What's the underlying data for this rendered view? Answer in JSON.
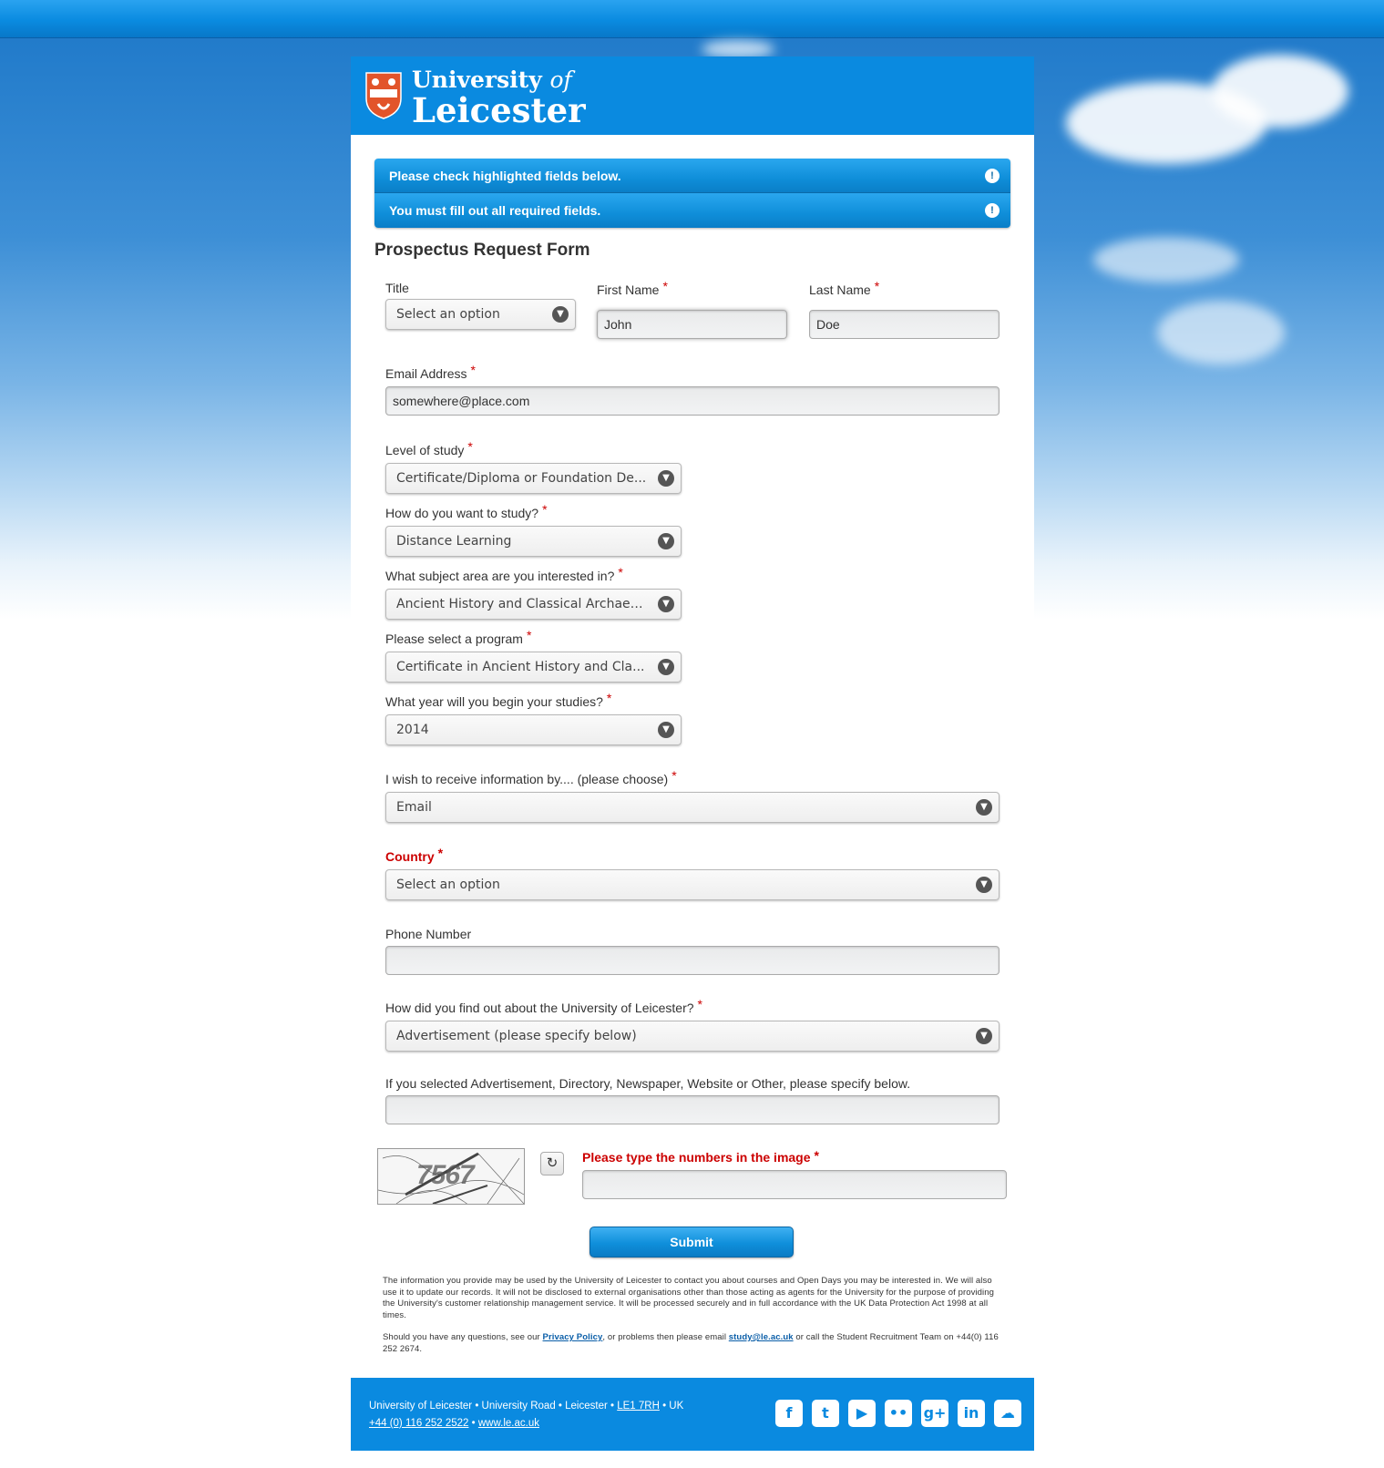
{
  "header": {
    "logo_line1": "University ",
    "logo_of": "of",
    "logo_line2": "Leicester"
  },
  "alerts": [
    "Please check highlighted fields below.",
    "You must fill out all required fields."
  ],
  "form_title": "Prospectus Request Form",
  "fields": {
    "title": {
      "label": "Title",
      "value": "Select an option"
    },
    "first_name": {
      "label": "First Name",
      "value": "John"
    },
    "last_name": {
      "label": "Last Name",
      "value": "Doe"
    },
    "email": {
      "label": "Email Address",
      "value": "somewhere@place.com"
    },
    "level": {
      "label": "Level of study",
      "value": "Certificate/Diploma or Foundation De..."
    },
    "how_study": {
      "label": "How do you want to study?",
      "value": "Distance Learning"
    },
    "subject": {
      "label": "What subject area are you interested in?",
      "value": "Ancient History and Classical Archaeo..."
    },
    "program": {
      "label": "Please select a program",
      "value": "Certificate in Ancient History and Cla..."
    },
    "year": {
      "label": "What year will you begin your studies?",
      "value": "2014"
    },
    "receive_by": {
      "label": "I wish to receive information by.... (please choose)",
      "value": "Email"
    },
    "country": {
      "label": "Country",
      "value": "Select an option"
    },
    "phone": {
      "label": "Phone Number",
      "value": ""
    },
    "found_out": {
      "label": "How did you find out about the University of Leicester?",
      "value": "Advertisement (please specify below)"
    },
    "specify": {
      "label": "If you selected Advertisement, Directory, Newspaper, Website or Other, please specify below.",
      "value": ""
    },
    "captcha": {
      "label": "Please type the numbers in the image",
      "image_text": "7567",
      "value": ""
    }
  },
  "required_mark": "*",
  "submit_label": "Submit",
  "fine_print": {
    "para1": "The information you provide may be used by the University of Leicester to contact you about courses and Open Days you may be interested in. We will also use it to update our records. It will not be disclosed to external organisations other than those acting as agents for the University for the purpose of providing the University's customer relationship management service. It will be processed securely and in full accordance with the UK Data Protection Act 1998 at all times.",
    "para2_a": "Should you have any questions, see our ",
    "privacy_link": "Privacy Policy",
    "para2_b": ", or problems then please email ",
    "email_link": "study@le.ac.uk",
    "para2_c": " or call the Student Recruitment Team on +44(0) 116 252 2674."
  },
  "footer": {
    "addr_a": "University of Leicester • University Road • Leicester • ",
    "postcode": "LE1 7RH",
    "addr_b": " • UK",
    "phone": "+44 (0) 116 252 2522",
    "sep": " • ",
    "website": "www.le.ac.uk",
    "social": [
      "facebook-icon",
      "twitter-icon",
      "youtube-icon",
      "flickr-icon",
      "googleplus-icon",
      "linkedin-icon",
      "soundcloud-icon"
    ]
  },
  "colors": {
    "brand_blue": "#0a8ae0",
    "error_red": "#cc0000"
  }
}
